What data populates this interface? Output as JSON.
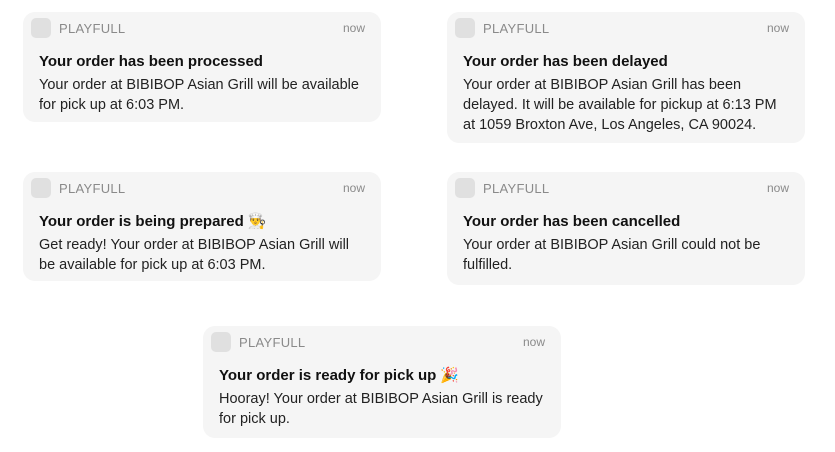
{
  "notifications": [
    {
      "app": "PLAYFULL",
      "time": "now",
      "title": "Your order has been processed",
      "emoji": "",
      "body": "Your order at BIBIBOP Asian Grill will be available for pick up at 6:03 PM."
    },
    {
      "app": "PLAYFULL",
      "time": "now",
      "title": "Your order has been delayed",
      "emoji": "",
      "body": "Your order at BIBIBOP Asian Grill has been delayed. It will be available for pickup at 6:13 PM at 1059 Broxton Ave, Los Angeles, CA 90024."
    },
    {
      "app": "PLAYFULL",
      "time": "now",
      "title": "Your order is being prepared",
      "emoji": "👨‍🍳",
      "body": "Get ready! Your order at BIBIBOP Asian Grill will be available for pick up at 6:03 PM."
    },
    {
      "app": "PLAYFULL",
      "time": "now",
      "title": "Your order has been cancelled",
      "emoji": "",
      "body": "Your order at BIBIBOP Asian Grill could not be fulfilled."
    },
    {
      "app": "PLAYFULL",
      "time": "now",
      "title": "Your order is ready for pick up",
      "emoji": "🎉",
      "body": "Hooray! Your order at BIBIBOP Asian Grill is ready for pick up."
    }
  ]
}
